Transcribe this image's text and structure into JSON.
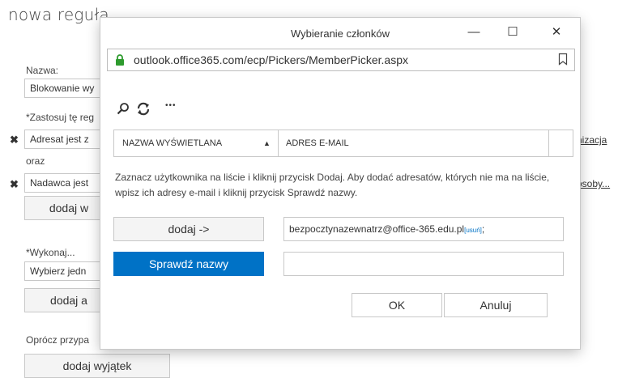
{
  "background": {
    "page_title": "nowa reguła",
    "name_label": "Nazwa:",
    "name_value": "Blokowanie wy",
    "apply_label": "*Zastosuj tę reg",
    "condition1_value": "Adresat jest z",
    "and_label": "oraz",
    "condition2_value": "Nadawca jest",
    "add_condition_label": "dodaj w",
    "do_label": "*Wykonaj...",
    "action_value": "Wybierz jedn",
    "add_action_label": "dodaj a",
    "except_label": "Oprócz przypa",
    "add_exception_label": "dodaj wyjątek",
    "right_link1": "nizacja",
    "right_link2": "osoby..."
  },
  "dialog": {
    "title": "Wybieranie członków",
    "url": "outlook.office365.com/ecp/Pickers/MemberPicker.aspx",
    "toolbar": {
      "search_icon": "search-icon",
      "refresh_icon": "refresh-icon",
      "more_label": "•••"
    },
    "columns": [
      "NAZWA WYŚWIETLANA",
      "ADRES E-MAIL"
    ],
    "sort_indicator": "▲",
    "help_text": "Zaznacz użytkownika na liście i kliknij przycisk Dodaj. Aby dodać adresatów, których nie ma na liście, wpisz ich adresy e-mail i kliknij przycisk Sprawdź nazwy.",
    "add_button": "dodaj ->",
    "check_names_button": "Sprawdź nazwy",
    "recipient_value": "bezpocztynazewnatrz@office-365.edu.pl",
    "remove_link": "[usuń]",
    "recipient_separator": ";",
    "ok_button": "OK",
    "cancel_button": "Anuluj",
    "window_controls": {
      "minimize": "—",
      "maximize": "☐",
      "close": "✕"
    },
    "accent_color": "#0072c6",
    "lock_color": "#2e9b2e"
  }
}
